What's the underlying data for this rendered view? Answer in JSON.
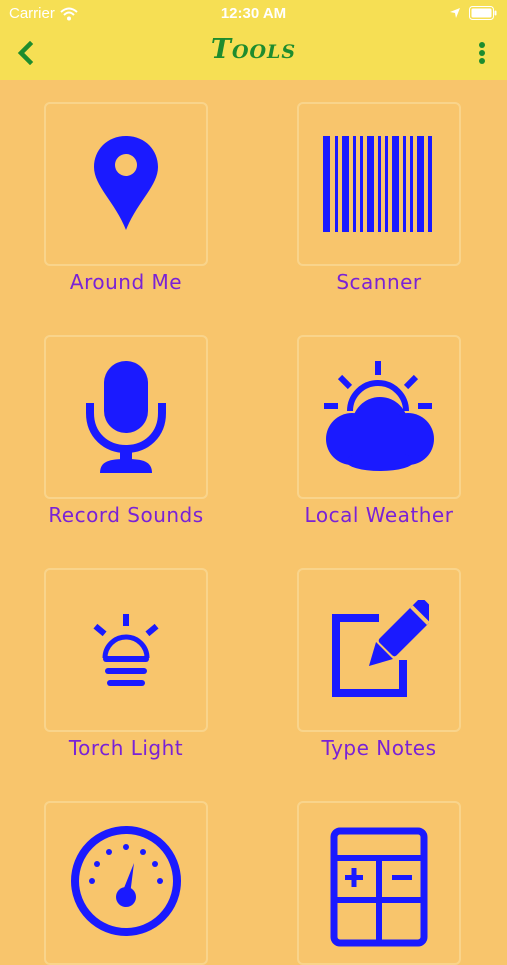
{
  "status_bar": {
    "carrier": "Carrier",
    "time": "12:30 AM",
    "wifi_icon": "wifi-icon",
    "location_icon": "location-arrow-icon",
    "battery_icon": "battery-icon"
  },
  "navbar": {
    "title": "Tools",
    "back_icon": "chevron-left-icon",
    "more_icon": "more-vertical-icon"
  },
  "colors": {
    "background": "#f8c56c",
    "header": "#f6df54",
    "title": "#1e8c2e",
    "icon": "#1a1aff",
    "label": "#7a22d6"
  },
  "tools": [
    {
      "label": "Around Me",
      "icon": "map-pin-icon"
    },
    {
      "label": "Scanner",
      "icon": "barcode-icon"
    },
    {
      "label": "Record Sounds",
      "icon": "microphone-icon"
    },
    {
      "label": "Local Weather",
      "icon": "weather-icon"
    },
    {
      "label": "Torch Light",
      "icon": "torch-icon"
    },
    {
      "label": "Type Notes",
      "icon": "notes-icon"
    },
    {
      "label": "",
      "icon": "speedometer-icon"
    },
    {
      "label": "",
      "icon": "calculator-icon"
    }
  ]
}
